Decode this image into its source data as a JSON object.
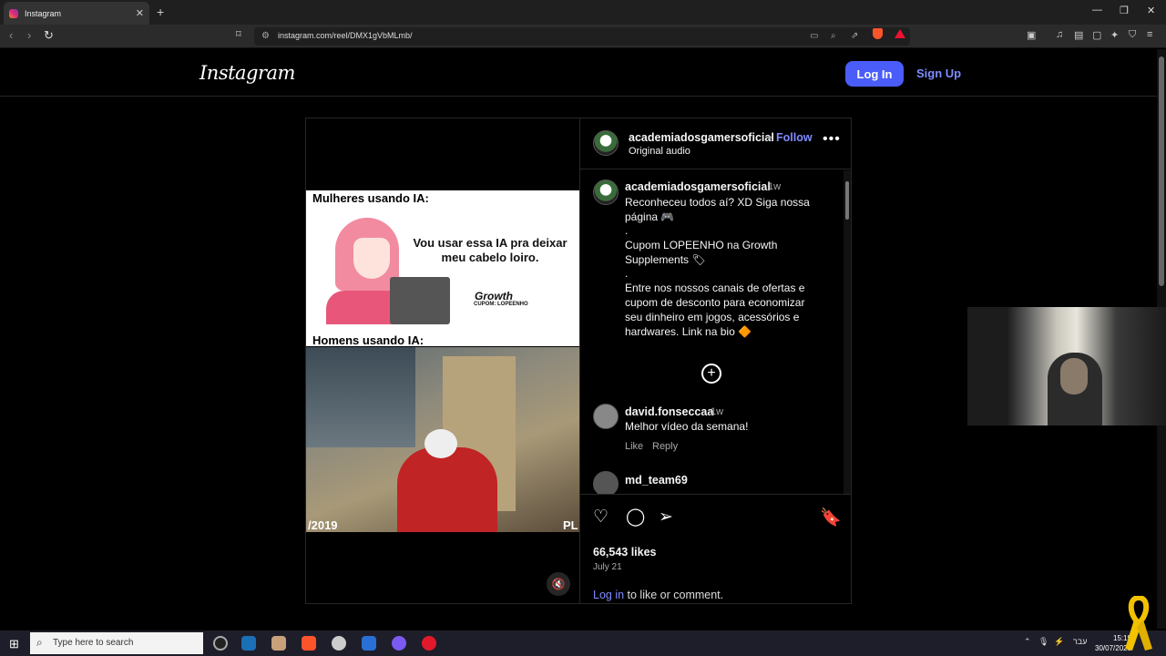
{
  "browser": {
    "tab_title": "Instagram",
    "tab_close": "✕",
    "new_tab": "+",
    "url": "instagram.com/reel/DMX1gVbMLmb/",
    "window": {
      "minimize": "—",
      "restore": "❐",
      "close": "✕"
    }
  },
  "header": {
    "logo": "Instagram",
    "login_label": "Log In",
    "signup_label": "Sign Up"
  },
  "post": {
    "media": {
      "meme_top_title": "Mulheres usando IA:",
      "meme_speech": "Vou usar essa IA pra deixar meu cabelo loiro.",
      "brand": "Growth",
      "brand_sub": "CUPOM: LOPEENHO",
      "meme_bottom_title": "Homens usando IA:",
      "video_timestamp": "/2019",
      "video_watermark": "PL"
    },
    "author": {
      "username": "academiadosgamersoficial",
      "follow_separator": "•",
      "follow_label": "Follow",
      "audio": "Original audio"
    },
    "caption": {
      "username": "academiadosgamersoficial",
      "time": "1w",
      "line1": "Reconheceu todos aí? XD Siga nossa página 🎮",
      "dot1": ".",
      "line2": "Cupom LOPEENHO na Growth Supplements 🏷",
      "dot2": ".",
      "line3": "Entre nos nossos canais de ofertas e cupom de desconto para economizar seu dinheiro em jogos, acessórios e hardwares. Link na bio 🔶"
    },
    "comments": [
      {
        "username": "david.fonseccaa",
        "time": "1w",
        "text": "Melhor vídeo da semana!",
        "like": "Like",
        "reply": "Reply"
      },
      {
        "username": "md_team69"
      }
    ],
    "likes": "66,543 likes",
    "date": "July 21",
    "login_link": "Log in",
    "login_suffix": " to like or comment."
  },
  "taskbar": {
    "search_placeholder": "Type here to search",
    "lang": "עבר",
    "time": "15:19",
    "date": "30/07/2025"
  },
  "colors": {
    "accent": "#4a5df9",
    "link": "#7f8cff",
    "background": "#000000"
  }
}
